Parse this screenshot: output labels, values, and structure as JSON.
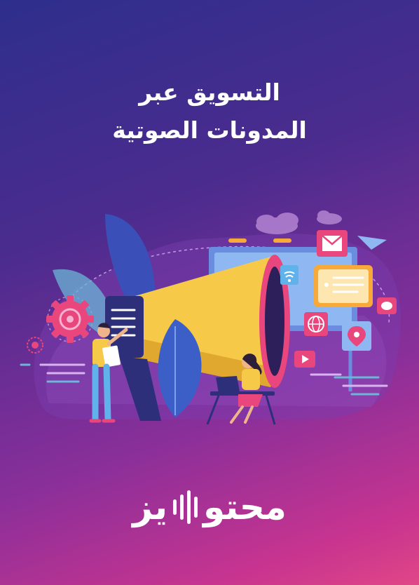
{
  "cover": {
    "title_line_1": "التسويق عبر",
    "title_line_2": "المدونات الصوتية"
  },
  "logo": {
    "brand_right": "محتو",
    "brand_left": "يز"
  },
  "colors": {
    "background_top": "#2e2e8c",
    "background_bottom": "#e04687",
    "text": "#ffffff",
    "megaphone_yellow": "#f7c948",
    "accent_pink": "#e8467c",
    "accent_blue": "#5fb3ea"
  },
  "icons": [
    "gear-icon",
    "target-icon",
    "wifi-icon",
    "globe-icon",
    "play-icon",
    "mail-icon",
    "chat-icon",
    "location-pin-icon",
    "paper-plane-icon",
    "laptop-icon"
  ]
}
